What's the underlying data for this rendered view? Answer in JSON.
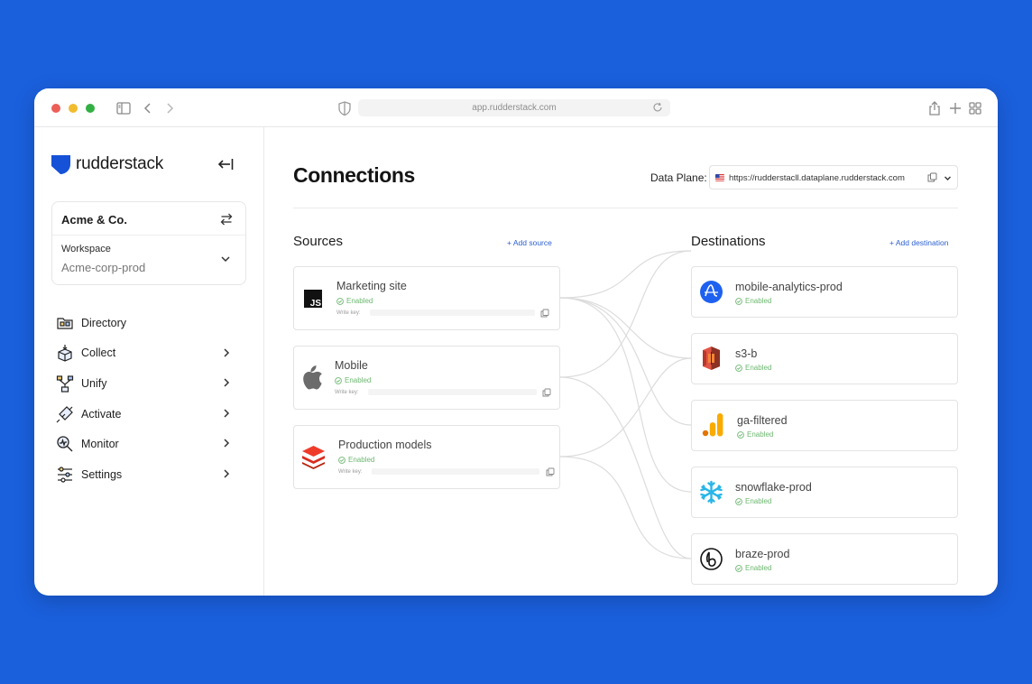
{
  "browser": {
    "url": "app.rudderstack.com"
  },
  "sidebar": {
    "brand": "rudderstack",
    "org_name": "Acme & Co.",
    "workspace_label": "Workspace",
    "workspace_value": "Acme-corp-prod",
    "nav": [
      {
        "label": "Directory",
        "icon": "directory-icon",
        "has_chevron": false
      },
      {
        "label": "Collect",
        "icon": "collect-icon",
        "has_chevron": true
      },
      {
        "label": "Unify",
        "icon": "unify-icon",
        "has_chevron": true
      },
      {
        "label": "Activate",
        "icon": "activate-icon",
        "has_chevron": true
      },
      {
        "label": "Monitor",
        "icon": "monitor-icon",
        "has_chevron": true
      },
      {
        "label": "Settings",
        "icon": "settings-icon",
        "has_chevron": true
      }
    ]
  },
  "main": {
    "title": "Connections",
    "data_plane_label": "Data Plane:",
    "data_plane_url": "https://rudderstacll.dataplane.rudderstack.com",
    "sources_title": "Sources",
    "add_source": "+ Add source",
    "destinations_title": "Destinations",
    "add_destination": "+ Add destination",
    "sources": [
      {
        "name": "Marketing site",
        "status": "Enabled",
        "write_key_label": "Write key:",
        "icon": "javascript-icon"
      },
      {
        "name": "Mobile",
        "status": "Enabled",
        "write_key_label": "Write key:",
        "icon": "apple-icon"
      },
      {
        "name": "Production models",
        "status": "Enabled",
        "write_key_label": "Write key:",
        "icon": "layers-icon"
      }
    ],
    "destinations": [
      {
        "name": "mobile-analytics-prod",
        "status": "Enabled",
        "icon": "amplitude-icon"
      },
      {
        "name": "s3-b",
        "status": "Enabled",
        "icon": "aws-s3-icon"
      },
      {
        "name": "ga-filtered",
        "status": "Enabled",
        "icon": "google-analytics-icon"
      },
      {
        "name": "snowflake-prod",
        "status": "Enabled",
        "icon": "snowflake-icon"
      },
      {
        "name": "braze-prod",
        "status": "Enabled",
        "icon": "braze-icon"
      }
    ]
  },
  "colors": {
    "background": "#1a5fdc",
    "brand": "#1652d8",
    "link": "#2c5fcf",
    "enabled": "#6db870"
  }
}
